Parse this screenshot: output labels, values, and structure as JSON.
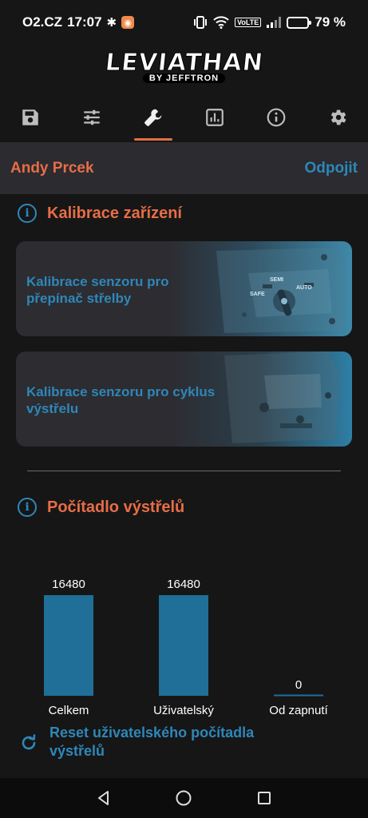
{
  "status_bar": {
    "carrier": "O2.CZ",
    "time": "17:07",
    "battery": "79 %",
    "battery_level": 0.79,
    "volte": "VoLTE"
  },
  "logo": {
    "main": "LEVIATHAN",
    "sub": "BY JEFFTRON"
  },
  "tabs": [
    {
      "icon": "save-icon",
      "active": false
    },
    {
      "icon": "sliders-icon",
      "active": false
    },
    {
      "icon": "wrench-icon",
      "active": true
    },
    {
      "icon": "chart-icon",
      "active": false
    },
    {
      "icon": "info-icon",
      "active": false
    },
    {
      "icon": "gear-icon",
      "active": false
    }
  ],
  "device": {
    "name": "Andy Prcek",
    "disconnect_label": "Odpojit"
  },
  "calibration": {
    "title": "Kalibrace zařízení",
    "cards": [
      {
        "label": "Kalibrace senzoru pro přepínač střelby",
        "image_labels": [
          "SEMI",
          "SAFE",
          "AUTO"
        ]
      },
      {
        "label": "Kalibrace senzoru pro cyklus výstřelu"
      }
    ]
  },
  "counter": {
    "title": "Počítadlo výstřelů",
    "reset_label": "Reset uživatelského počítadla výstřelů"
  },
  "chart_data": {
    "type": "bar",
    "categories": [
      "Celkem",
      "Uživatelský",
      "Od zapnutí"
    ],
    "values": [
      16480,
      16480,
      0
    ],
    "data_labels": [
      "16480",
      "16480",
      "0"
    ],
    "color": "#1f6f98",
    "title": "",
    "xlabel": "",
    "ylabel": ""
  },
  "colors": {
    "accent": "#e76d47",
    "link": "#2f87b8",
    "background": "#161616",
    "surface": "#2b2b30"
  }
}
